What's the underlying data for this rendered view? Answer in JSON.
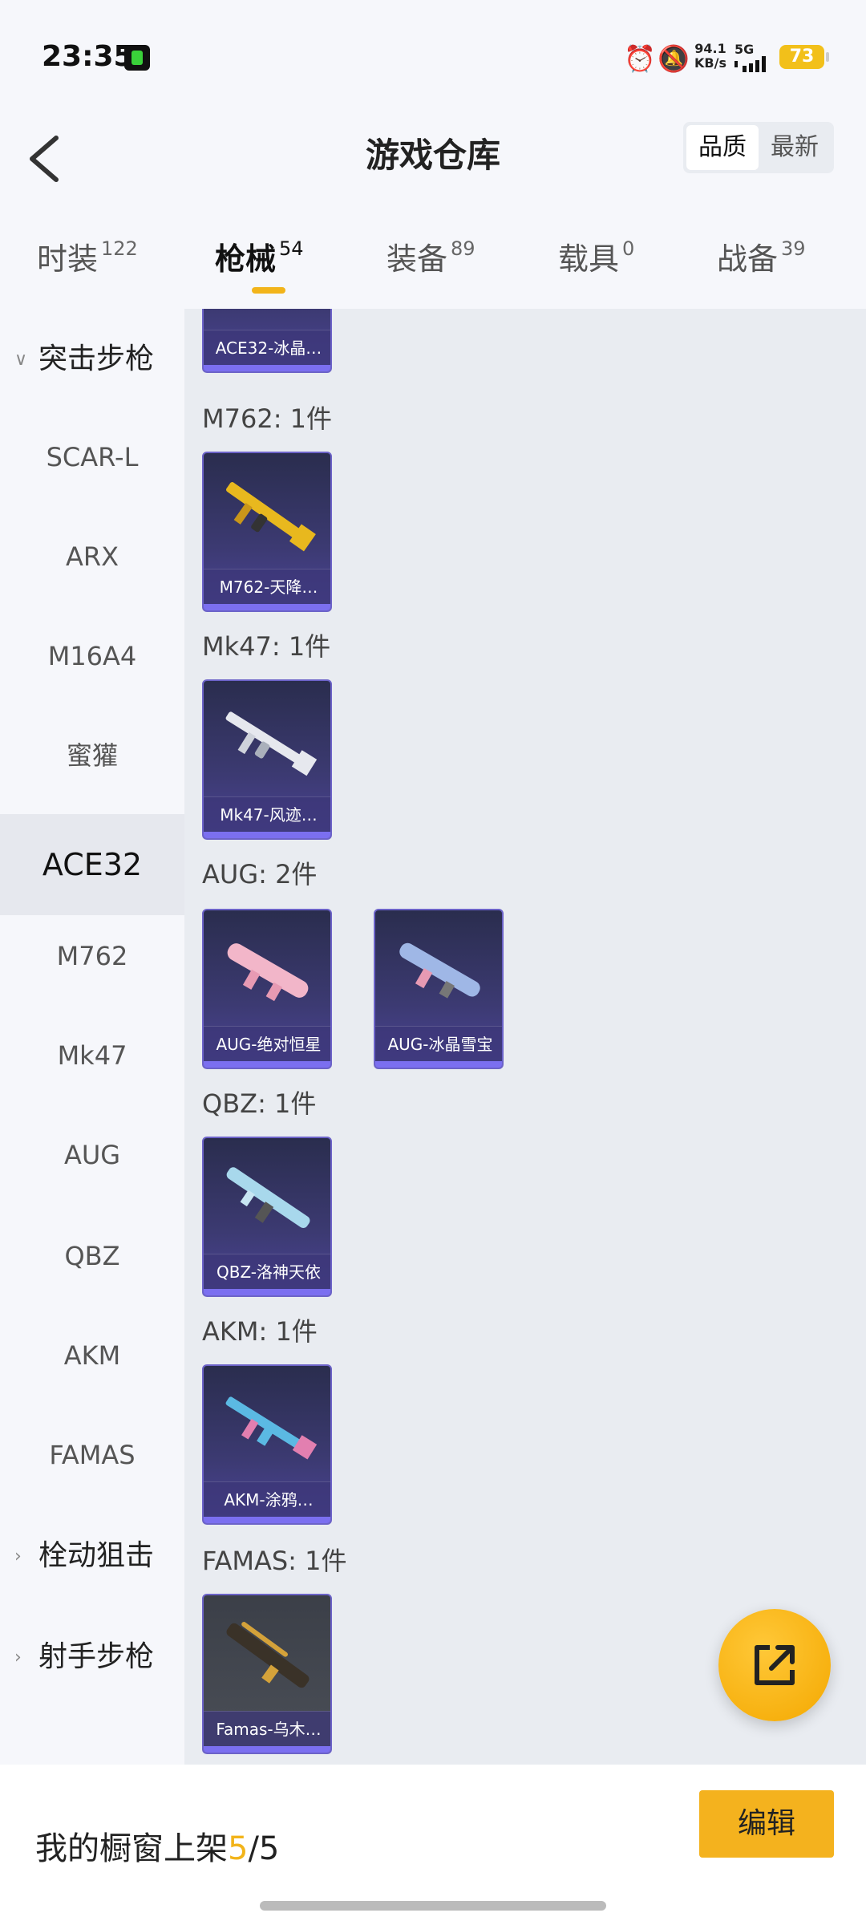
{
  "status_bar": {
    "time": "23:35",
    "speed_value": "94.1",
    "speed_unit": "KB/s",
    "network": "5G",
    "battery": "73"
  },
  "header": {
    "title": "游戏仓库",
    "sort_options": [
      "品质",
      "最新"
    ],
    "sort_selected": "品质"
  },
  "tabs": [
    {
      "label": "时装",
      "count": "122"
    },
    {
      "label": "枪械",
      "count": "54"
    },
    {
      "label": "装备",
      "count": "89"
    },
    {
      "label": "载具",
      "count": "0"
    },
    {
      "label": "战备",
      "count": "39"
    }
  ],
  "active_tab": "枪械",
  "sidebar": {
    "category_expanded": "突击步枪",
    "items": [
      "SCAR-L",
      "ARX",
      "M16A4",
      "蜜獾",
      "ACE32",
      "M762",
      "Mk47",
      "AUG",
      "QBZ",
      "AKM",
      "FAMAS"
    ],
    "active_item": "ACE32",
    "collapsed_categories": [
      "栓动狙击",
      "射手步枪"
    ]
  },
  "content": {
    "partial_top_card": "ACE32-冰晶…",
    "sections": [
      {
        "title": "M762: 1件",
        "cards": [
          {
            "name": "M762-天降…"
          }
        ]
      },
      {
        "title": "Mk47: 1件",
        "cards": [
          {
            "name": "Mk47-风迹…"
          }
        ]
      },
      {
        "title": "AUG: 2件",
        "cards": [
          {
            "name": "AUG-绝对恒星"
          },
          {
            "name": "AUG-冰晶雪宝"
          }
        ]
      },
      {
        "title": "QBZ: 1件",
        "cards": [
          {
            "name": "QBZ-洛神天依"
          }
        ]
      },
      {
        "title": "AKM: 1件",
        "cards": [
          {
            "name": "AKM-涂鸦…"
          }
        ]
      },
      {
        "title": "FAMAS: 1件",
        "cards": [
          {
            "name": "Famas-乌木…"
          }
        ]
      }
    ]
  },
  "bottom_bar": {
    "label_prefix": "我的橱窗上架",
    "count_current": "5",
    "count_total": "/5",
    "edit_label": "编辑"
  },
  "colors": {
    "accent": "#f4b21e",
    "card_border": "#6c63c8"
  }
}
